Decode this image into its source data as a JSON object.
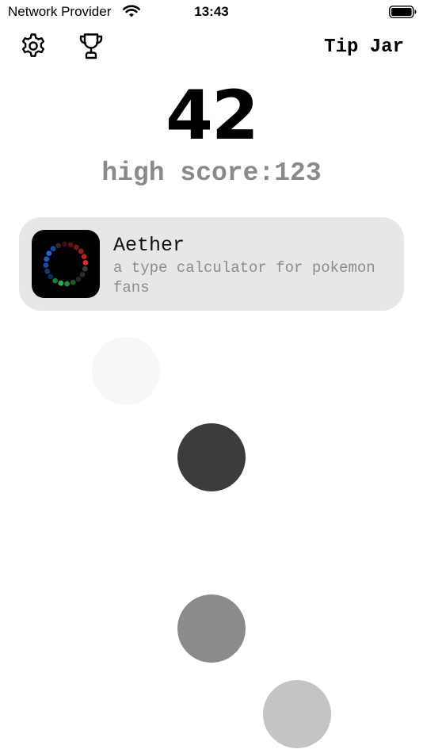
{
  "status_bar": {
    "carrier": "Network Provider",
    "time": "13:43",
    "wifi_icon": "wifi-icon",
    "battery_icon": "battery-full-icon"
  },
  "toolbar": {
    "settings_icon": "gear-icon",
    "leaderboard_icon": "trophy-icon",
    "tip_jar_label": "Tip Jar"
  },
  "score": {
    "current": "42",
    "high_score_label": "high score:123"
  },
  "ad": {
    "app_name": "Aether",
    "description": "a type calculator for pokemon fans",
    "icon": "aether-app-icon"
  },
  "game": {
    "circles": [
      {
        "color": "#f7f7f7"
      },
      {
        "color": "#3c3c3c"
      },
      {
        "color": "#8b8b8b"
      },
      {
        "color": "#c4c4c4"
      }
    ]
  },
  "colors": {
    "background": "#ffffff",
    "card_background": "#e7e7ea",
    "muted_text": "#8a8a8a"
  }
}
